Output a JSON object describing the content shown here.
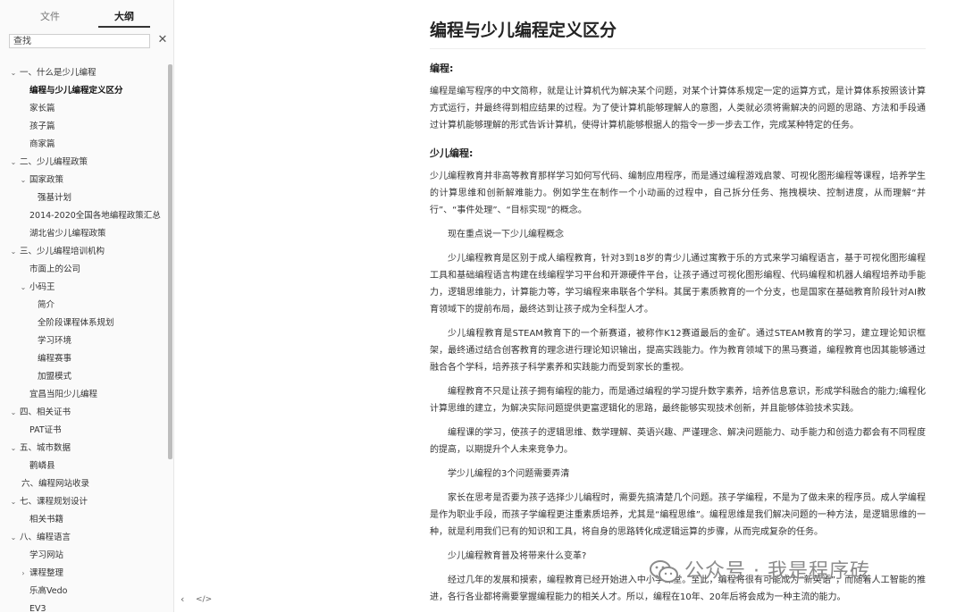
{
  "sidebar": {
    "tabs": {
      "files": "文件",
      "outline": "大纲"
    },
    "search": {
      "value": "",
      "placeholder": "查找"
    },
    "items": [
      {
        "label": "一、什么是少儿编程",
        "level": 0,
        "caret": "down"
      },
      {
        "label": "编程与少儿编程定义区分",
        "level": 1,
        "active": true
      },
      {
        "label": "家长篇",
        "level": 1
      },
      {
        "label": "孩子篇",
        "level": 1
      },
      {
        "label": "商家篇",
        "level": 1
      },
      {
        "label": "二、少儿编程政策",
        "level": 0,
        "caret": "down"
      },
      {
        "label": "国家政策",
        "level": 1,
        "caret": "down"
      },
      {
        "label": "强基计划",
        "level": 2
      },
      {
        "label": "2014-2020全国各地编程政策汇总",
        "level": 1
      },
      {
        "label": "湖北省少儿编程政策",
        "level": 1
      },
      {
        "label": "三、少儿编程培训机构",
        "level": 0,
        "caret": "down"
      },
      {
        "label": "市面上的公司",
        "level": 1
      },
      {
        "label": "小码王",
        "level": 1,
        "caret": "down"
      },
      {
        "label": "简介",
        "level": 2
      },
      {
        "label": "全阶段课程体系规划",
        "level": 2
      },
      {
        "label": "学习环境",
        "level": 2
      },
      {
        "label": "编程赛事",
        "level": 2
      },
      {
        "label": "加盟模式",
        "level": 2
      },
      {
        "label": "宜昌当阳少儿编程",
        "level": 1
      },
      {
        "label": "四、相关证书",
        "level": 0,
        "caret": "down"
      },
      {
        "label": "PAT证书",
        "level": 1
      },
      {
        "label": "五、城市数据",
        "level": 0,
        "caret": "down"
      },
      {
        "label": "鹳嶙县",
        "level": 1
      },
      {
        "label": "六、编程网站收录",
        "level": 0
      },
      {
        "label": "七、课程规划设计",
        "level": 0,
        "caret": "down"
      },
      {
        "label": "相关书籍",
        "level": 1
      },
      {
        "label": "八、编程语言",
        "level": 0,
        "caret": "down"
      },
      {
        "label": "学习网站",
        "level": 1
      },
      {
        "label": "课程整理",
        "level": 1,
        "caret": "right"
      },
      {
        "label": "乐高Vedo",
        "level": 1
      },
      {
        "label": "EV3",
        "level": 1
      }
    ]
  },
  "doc": {
    "title": "编程与少儿编程定义区分",
    "section1": "编程:",
    "p1": "编程是编写程序的中文简称，就是让计算机代为解决某个问题，对某个计算体系规定一定的运算方式，是计算体系按照该计算方式运行，并最终得到相应结果的过程。为了使计算机能够理解人的意图，人类就必须将需解决的问题的思路、方法和手段通过计算机能够理解的形式告诉计算机，使得计算机能够根据人的指令一步一步去工作，完成某种特定的任务。",
    "section2": "少儿编程:",
    "p2": "少儿编程教育并非高等教育那样学习如何写代码、编制应用程序，而是通过编程游戏启蒙、可视化图形编程等课程，培养学生的计算思维和创新解难能力。例如学生在制作一个小动画的过程中，自己拆分任务、拖拽模块、控制进度，从而理解“并行”、“事件处理”、“目标实现”的概念。",
    "p3": "现在重点说一下少儿编程概念",
    "p4": "少儿编程教育是区别于成人编程教育，针对3到18岁的青少儿通过寓教于乐的方式来学习编程语言，基于可视化图形编程工具和基础编程语言构建在线编程学习平台和开源硬件平台，让孩子通过可视化图形编程、代码编程和机器人编程培养动手能力，逻辑思维能力，计算能力等，学习编程来串联各个学科。其属于素质教育的一个分支，也是国家在基础教育阶段针对AI教育领域下的提前布局，最终达到让孩子成为全科型人才。",
    "p5": "少儿编程教育是STEAM教育下的一个新赛道，被称作K12赛道最后的金矿。通过STEAM教育的学习，建立理论知识框架，最终通过结合创客教育的理念进行理论知识输出，提高实践能力。作为教育领域下的黑马赛道，编程教育也因其能够通过融合各个学科，培养孩子科学素养和实践能力而受到家长的重视。",
    "p6": "编程教育不只是让孩子拥有编程的能力，而是通过编程的学习提升数字素养，培养信息意识，形成学科融合的能力;编程化计算思维的建立，为解决实际问题提供更富逻辑化的思路，最终能够实现技术创新，并且能够体验技术实践。",
    "p7": "编程课的学习，使孩子的逻辑思维、数学理解、英语兴趣、严谨理念、解决问题能力、动手能力和创造力都会有不同程度的提高，以期提升个人未来竞争力。",
    "p8": "学少儿编程的3个问题需要弄清",
    "p9": "家长在思考是否要为孩子选择少儿编程时，需要先搞清楚几个问题。孩子学编程，不是为了做未来的程序员。成人学编程是作为职业手段，而孩子学编程更注重素质培养，尤其是“编程思维”。编程思维是我们解决问题的一种方法，是逻辑思维的一种，就是利用我们已有的知识和工具，将自身的思路转化成逻辑运算的步骤，从而完成复杂的任务。",
    "p10": "少儿编程教育普及将带来什么变革?",
    "p11": "经过几年的发展和摸索，编程教育已经开始进入中小学课堂。至此，编程将很有可能成为“新英语”，而随着人工智能的推进，各行各业都将需要掌握编程能力的相关人才。所以，编程在10年、20年后将会成为一种主流的能力。"
  },
  "watermark": {
    "text": "公众号 · 我是程序砖"
  },
  "colors": {
    "accent": "#333333",
    "sidebar_bg": "#fafafa",
    "scrollbar": "#bdbdbd",
    "watermark": "#8b8b8b"
  }
}
